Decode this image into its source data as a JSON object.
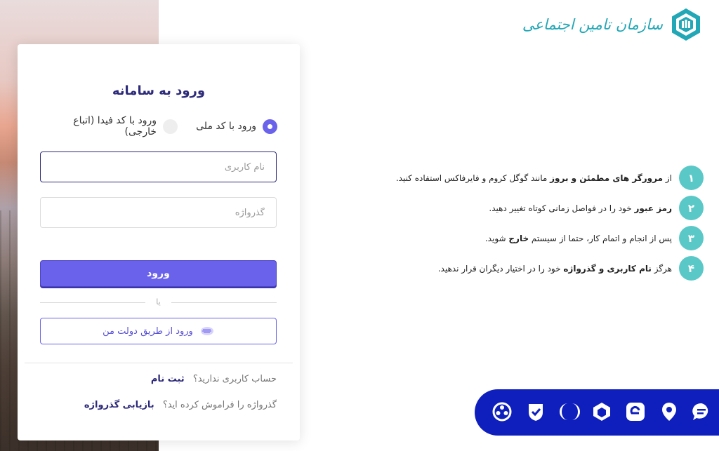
{
  "login": {
    "title": "ورود به سامانه",
    "radio_national_code": "ورود با کد ملی",
    "radio_fida_code": "ورود با کد فیدا (اتباع خارجی)",
    "username_placeholder": "نام کاربری",
    "password_placeholder": "گذرواژه",
    "login_button": "ورود",
    "or_text": "یا",
    "gov_login_button": "ورود از طریق دولت من",
    "no_account_text": "حساب کاربری ندارید؟",
    "register_link": "ثبت نام",
    "forgot_text": "گذرواژه را فراموش کرده اید؟",
    "recover_link": "بازیابی گذرواژه"
  },
  "brand": {
    "name": "سازمان تامین اجتماعی",
    "color": "#22a7b6"
  },
  "tips": [
    {
      "num": "۱",
      "before": "از ",
      "bold": "مرورگر های مطمئن و بروز",
      "after": " مانند گوگل کروم و فایرفاکس استفاده کنید."
    },
    {
      "num": "۲",
      "before": "",
      "bold": "رمز عبور",
      "after": " خود را در فواصل زمانی کوتاه تغییر دهید."
    },
    {
      "num": "۳",
      "before": "پس از انجام و اتمام کار، حتما از سیستم ",
      "bold": "خارج",
      "after": " شوید."
    },
    {
      "num": "۴",
      "before": "هرگز ",
      "bold": "نام کاربری و گذرواژه",
      "after": " خود را در اختیار دیگران قرار ندهید."
    }
  ],
  "apps": [
    "film-reel-icon",
    "shield-check-icon",
    "crescent-icon",
    "hexagon-icon",
    "e-logo-icon",
    "location-pin-icon",
    "chat-bubble-icon"
  ],
  "colors": {
    "primary": "#6a62ea",
    "dark_primary": "#2d2a7a",
    "tip_circle": "#5bc8c8",
    "app_bar": "#0f1fbe"
  }
}
